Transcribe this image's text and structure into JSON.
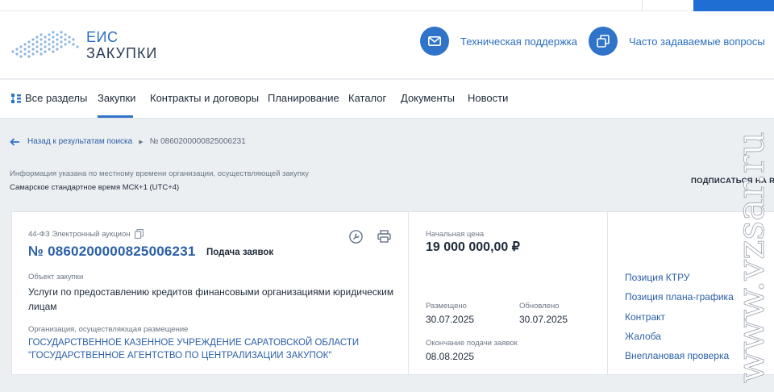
{
  "logo": {
    "line1": "ЕИС",
    "line2": "ЗАКУПКИ"
  },
  "header": {
    "support_label": "Техническая поддержка",
    "faq_label": "Часто задаваемые вопросы",
    "support_icon": "mail-icon",
    "faq_icon": "copy-windows-icon"
  },
  "nav": {
    "all_sections": "Все разделы",
    "items": [
      "Закупки",
      "Контракты и договоры",
      "Планирование",
      "Каталог",
      "Документы",
      "Новости"
    ],
    "active": "Закупки"
  },
  "breadcrumb": {
    "back": "Назад к результатам поиска",
    "current": "№ 0860200000825006231"
  },
  "info": {
    "note": "Информация указана по местному времени организации, осуществляющей закупку",
    "timezone": "Самарское стандартное время МСК+1 (UTC+4)",
    "subscribe": "ПОДПИСАТЬСЯ НА R"
  },
  "card": {
    "law": "44-ФЗ Электронный аукцион",
    "reg_number": "№ 0860200000825006231",
    "stage": "Подача заявок",
    "object_label": "Объект закупки",
    "object_value": "Услуги по предоставлению кредитов финансовыми организациями юридическим лицам",
    "org_label": "Организация, осуществляющая размещение",
    "org_value": "ГОСУДАРСТВЕННОЕ КАЗЕННОЕ УЧРЕЖДЕНИЕ САРАТОВСКОЙ ОБЛАСТИ \"ГОСУДАРСТВЕННОЕ АГЕНТСТВО ПО ЦЕНТРАЛИЗАЦИИ ЗАКУПОК\"",
    "price_label": "Начальная цена",
    "price_value": "19 000 000,00 ₽",
    "posted_label": "Размещено",
    "posted_value": "30.07.2025",
    "updated_label": "Обновлено",
    "updated_value": "30.07.2025",
    "deadline_label": "Окончание подачи заявок",
    "deadline_value": "08.08.2025",
    "links": [
      "Позиция КТРУ",
      "Позиция плана-графика",
      "Контракт",
      "Жалоба",
      "Внеплановая проверка"
    ]
  },
  "watermark": "www.vzsar.ru",
  "colors": {
    "accent": "#2f74c9",
    "link": "#2a5fa8",
    "background": "#eceff2"
  }
}
